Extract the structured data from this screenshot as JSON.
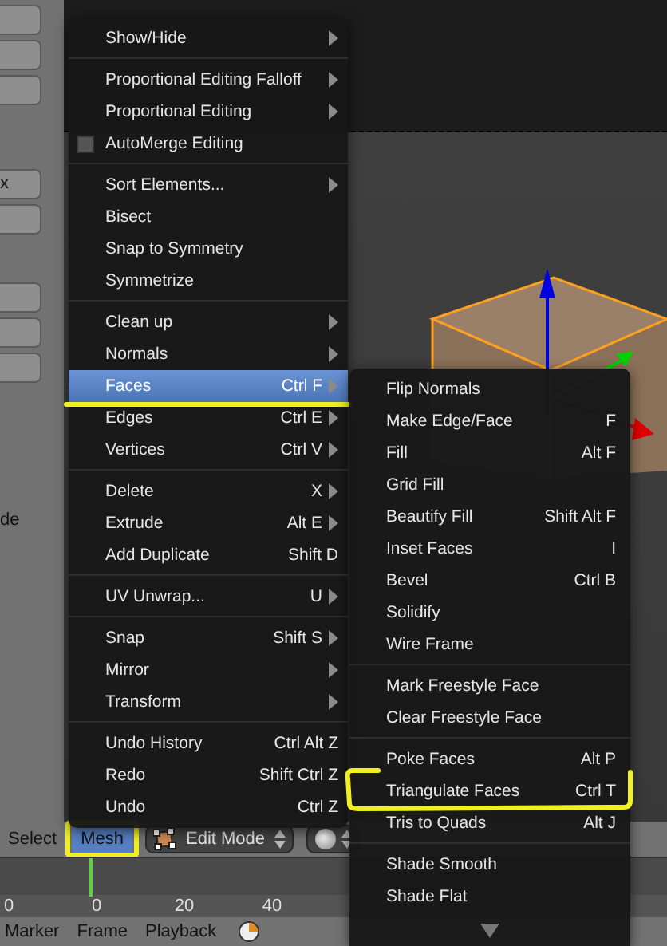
{
  "left_panel": {
    "texts": [
      "x",
      "de"
    ]
  },
  "header": {
    "items": [
      {
        "label": "Select",
        "selected": false,
        "highlighted": false
      },
      {
        "label": "Mesh",
        "selected": true,
        "highlighted": true
      }
    ],
    "mode": {
      "value": "Edit Mode"
    }
  },
  "timeline": {
    "ticks": [
      "0",
      "0",
      "20",
      "40"
    ]
  },
  "bottom_bar": {
    "menus": [
      "Marker",
      "Frame",
      "Playback"
    ]
  },
  "menu": {
    "sections": [
      {
        "items": [
          {
            "kind": "action",
            "label": "Show/Hide",
            "submenu": true,
            "selected": false,
            "highlighted": false
          }
        ]
      },
      {
        "items": [
          {
            "kind": "action",
            "label": "Proportional Editing Falloff",
            "submenu": true,
            "selected": false,
            "highlighted": false
          },
          {
            "kind": "action",
            "label": "Proportional Editing",
            "submenu": true,
            "selected": false,
            "highlighted": false
          },
          {
            "kind": "checkbox",
            "label": "AutoMerge Editing",
            "checked": false,
            "submenu": false,
            "selected": false,
            "highlighted": false
          }
        ]
      },
      {
        "items": [
          {
            "kind": "action",
            "label": "Sort Elements...",
            "submenu": true,
            "selected": false,
            "highlighted": false
          },
          {
            "kind": "action",
            "label": "Bisect",
            "submenu": false,
            "selected": false,
            "highlighted": false
          },
          {
            "kind": "action",
            "label": "Snap to Symmetry",
            "submenu": false,
            "selected": false,
            "highlighted": false
          },
          {
            "kind": "action",
            "label": "Symmetrize",
            "submenu": false,
            "selected": false,
            "highlighted": false
          }
        ]
      },
      {
        "items": [
          {
            "kind": "action",
            "label": "Clean up",
            "submenu": true,
            "selected": false,
            "highlighted": false
          },
          {
            "kind": "action",
            "label": "Normals",
            "submenu": true,
            "selected": false,
            "highlighted": false
          },
          {
            "kind": "action",
            "label": "Faces",
            "shortcut": "Ctrl F",
            "submenu": true,
            "selected": true,
            "highlighted": true
          },
          {
            "kind": "action",
            "label": "Edges",
            "shortcut": "Ctrl E",
            "submenu": true,
            "selected": false,
            "highlighted": false
          },
          {
            "kind": "action",
            "label": "Vertices",
            "shortcut": "Ctrl V",
            "submenu": true,
            "selected": false,
            "highlighted": false
          }
        ]
      },
      {
        "items": [
          {
            "kind": "action",
            "label": "Delete",
            "shortcut": "X",
            "submenu": true,
            "selected": false,
            "highlighted": false
          },
          {
            "kind": "action",
            "label": "Extrude",
            "shortcut": "Alt E",
            "submenu": true,
            "selected": false,
            "highlighted": false
          },
          {
            "kind": "action",
            "label": "Add Duplicate",
            "shortcut": "Shift D",
            "submenu": false,
            "selected": false,
            "highlighted": false
          }
        ]
      },
      {
        "items": [
          {
            "kind": "action",
            "label": "UV Unwrap...",
            "shortcut": "U",
            "submenu": true,
            "selected": false,
            "highlighted": false
          }
        ]
      },
      {
        "items": [
          {
            "kind": "action",
            "label": "Snap",
            "shortcut": "Shift S",
            "submenu": true,
            "selected": false,
            "highlighted": false
          },
          {
            "kind": "action",
            "label": "Mirror",
            "submenu": true,
            "selected": false,
            "highlighted": false
          },
          {
            "kind": "action",
            "label": "Transform",
            "submenu": true,
            "selected": false,
            "highlighted": false
          }
        ]
      },
      {
        "items": [
          {
            "kind": "action",
            "label": "Undo History",
            "shortcut": "Ctrl Alt Z",
            "submenu": false,
            "selected": false,
            "highlighted": false
          },
          {
            "kind": "action",
            "label": "Redo",
            "shortcut": "Shift Ctrl Z",
            "submenu": false,
            "selected": false,
            "highlighted": false
          },
          {
            "kind": "action",
            "label": "Undo",
            "shortcut": "Ctrl Z",
            "submenu": false,
            "selected": false,
            "highlighted": false
          }
        ]
      }
    ]
  },
  "submenu": {
    "sections": [
      {
        "items": [
          {
            "label": "Flip Normals",
            "submenu": false,
            "selected": false,
            "highlighted": false
          },
          {
            "label": "Make Edge/Face",
            "shortcut": "F",
            "submenu": false,
            "selected": false,
            "highlighted": false
          },
          {
            "label": "Fill",
            "shortcut": "Alt F",
            "submenu": false,
            "selected": false,
            "highlighted": false
          },
          {
            "label": "Grid Fill",
            "submenu": false,
            "selected": false,
            "highlighted": false
          },
          {
            "label": "Beautify Fill",
            "shortcut": "Shift Alt F",
            "submenu": false,
            "selected": false,
            "highlighted": false
          },
          {
            "label": "Inset Faces",
            "shortcut": "I",
            "submenu": false,
            "selected": false,
            "highlighted": false
          },
          {
            "label": "Bevel",
            "shortcut": "Ctrl B",
            "submenu": false,
            "selected": false,
            "highlighted": false
          },
          {
            "label": "Solidify",
            "submenu": false,
            "selected": false,
            "highlighted": false
          },
          {
            "label": "Wire Frame",
            "submenu": false,
            "selected": false,
            "highlighted": false
          }
        ]
      },
      {
        "items": [
          {
            "label": "Mark Freestyle Face",
            "submenu": false,
            "selected": false,
            "highlighted": false
          },
          {
            "label": "Clear Freestyle Face",
            "submenu": false,
            "selected": false,
            "highlighted": false
          }
        ]
      },
      {
        "items": [
          {
            "label": "Poke Faces",
            "shortcut": "Alt P",
            "submenu": false,
            "selected": false,
            "highlighted": false
          },
          {
            "label": "Triangulate Faces",
            "shortcut": "Ctrl T",
            "submenu": false,
            "selected": false,
            "highlighted": true
          },
          {
            "label": "Tris to Quads",
            "shortcut": "Alt J",
            "submenu": false,
            "selected": false,
            "highlighted": false
          }
        ]
      },
      {
        "items": [
          {
            "label": "Shade Smooth",
            "submenu": false,
            "selected": false,
            "highlighted": false
          },
          {
            "label": "Shade Flat",
            "submenu": false,
            "selected": false,
            "highlighted": false
          }
        ]
      }
    ]
  }
}
